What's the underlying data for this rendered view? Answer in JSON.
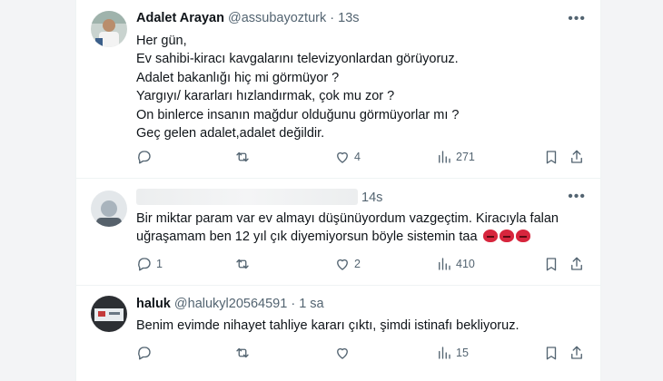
{
  "tweets": [
    {
      "name": "Adalet Arayan",
      "handle": "@assubayozturk",
      "sep": "·",
      "time": "13s",
      "lines": [
        "Her gün,",
        "Ev sahibi-kiracı kavgalarını televizyonlardan görüyoruz.",
        "Adalet bakanlığı hiç mi görmüyor ?",
        "Yargıyı/ kararları hızlandırmak, çok mu zor ?",
        "On binlerce insanın mağdur olduğunu görmüyorlar mı ?",
        "Geç gelen adalet,adalet değildir."
      ],
      "reply_count": "",
      "retweet_count": "",
      "like_count": "4",
      "view_count": "271"
    },
    {
      "name": "",
      "handle": "",
      "sep": "",
      "time": "14s",
      "lines": [
        "Bir miktar param var ev almayı düşünüyordum vazgeçtim. Kiracıyla falan",
        "uğraşamam ben 12 yıl çık diyemiyorsun böyle sistemin  taa"
      ],
      "reply_count": "1",
      "retweet_count": "",
      "like_count": "2",
      "view_count": "410"
    },
    {
      "name": "haluk",
      "handle": "@halukyl20564591",
      "sep": "·",
      "time": "1 sa",
      "lines": [
        "Benim evimde nihayet tahliye kararı çıktı, şimdi istinafı bekliyoruz."
      ],
      "reply_count": "",
      "retweet_count": "",
      "like_count": "",
      "view_count": "15"
    }
  ],
  "icons": {
    "reply": "reply-icon",
    "retweet": "retweet-icon",
    "like": "heart-icon",
    "views": "views-icon",
    "bookmark": "bookmark-icon",
    "share": "share-icon",
    "more": "more-icon",
    "emoji": "angry-face-emoji"
  },
  "more_glyph": "•••",
  "colors": {
    "text": "#0f1419",
    "muted": "#536471",
    "border": "#eff3f4",
    "emoji": "#d7263d"
  }
}
